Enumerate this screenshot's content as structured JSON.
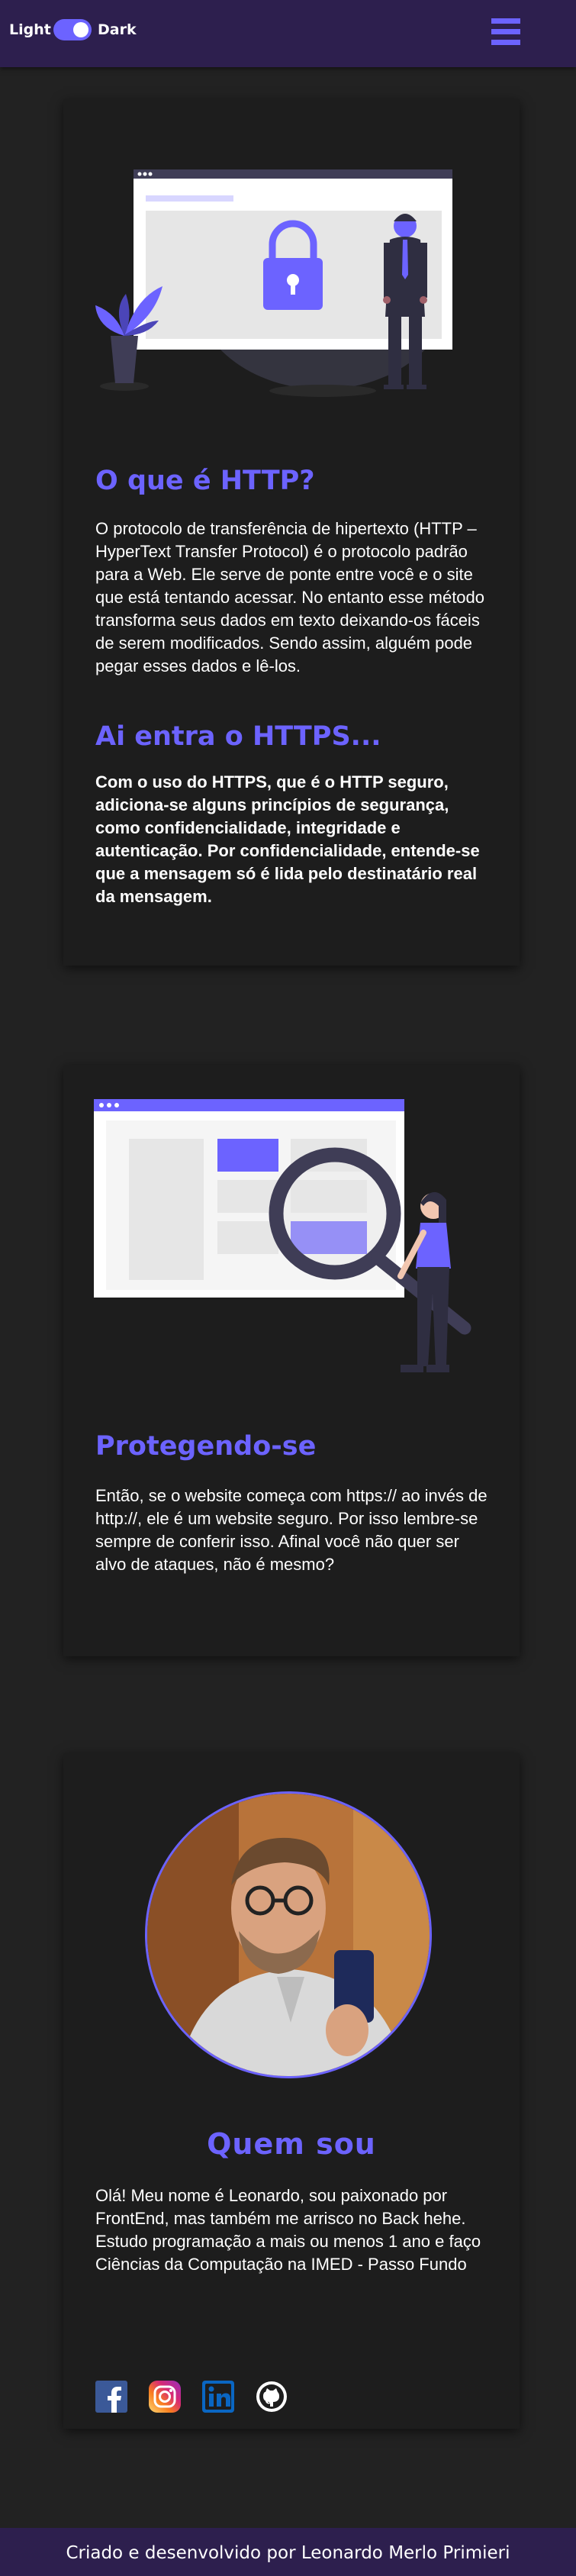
{
  "header": {
    "theme_light_label": "Light",
    "theme_dark_label": "Dark",
    "theme_mode": "dark"
  },
  "colors": {
    "accent": "#6c63ff",
    "background": "#222222",
    "card": "#1d1d1d",
    "header": "#2d1f4e"
  },
  "section_http": {
    "title": "O que é HTTP?",
    "text": "O protocolo de transferência de hipertexto (HTTP – HyperText Transfer Protocol) é o protocolo padrão para a Web. Ele serve de ponte entre você e o site que está tentando acessar. No entanto esse método transforma seus dados em texto deixando-os fáceis de serem modificados. Sendo assim, alguém pode pegar esses dados e lê-los.",
    "subtitle": "Ai entra o HTTPS...",
    "bold_text": "Com o uso do HTTPS, que é o HTTP seguro, adiciona-se alguns princípios de segurança, como confidencialidade, integridade e autenticação. Por confidencialidade, entende-se que a mensagem só é lida pelo destinatário real da mensagem."
  },
  "section_protect": {
    "title": "Protegendo-se",
    "text": "Então, se o website começa com https:// ao invés de http://, ele é um website seguro. Por isso lembre-se sempre de conferir isso. Afinal você não quer ser alvo de ataques, não é mesmo?"
  },
  "section_about": {
    "title": "Quem sou",
    "text": "Olá! Meu nome é Leonardo, sou paixonado por FrontEnd, mas também me arrisco no Back hehe. Estudo programação a mais ou menos 1 ano e faço Ciências da Computação na IMED - Passo Fundo",
    "socials": [
      "facebook-icon",
      "instagram-icon",
      "linkedin-icon",
      "github-icon"
    ]
  },
  "footer": {
    "text": "Criado e desenvolvido por Leonardo Merlo Primieri"
  }
}
